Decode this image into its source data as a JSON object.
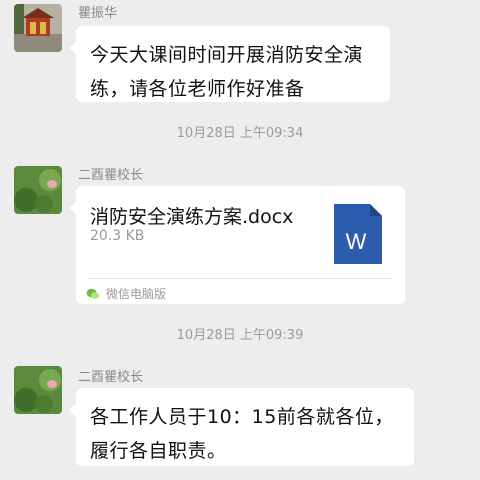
{
  "messages": [
    {
      "sender": "瞿振华",
      "text": "今天大课间时间开展消防安全演练，请各位老师作好准备"
    },
    {
      "timestamp": "10月28日 上午09:34"
    },
    {
      "sender": "二酉瞿校长",
      "file": {
        "name": "消防安全演练方案.docx",
        "size": "20.3 KB",
        "icon_letter": "W",
        "source": "微信电脑版"
      }
    },
    {
      "timestamp": "10月28日 上午09:39"
    },
    {
      "sender": "二酉瞿校长",
      "text": "各工作人员于10：15前各就各位，履行各自职责。"
    }
  ],
  "colors": {
    "background": "#ededed",
    "bubble": "#ffffff",
    "word_icon": "#2b5cad",
    "meta_text": "#8a8a8a"
  },
  "icons": [
    "avatar-temple-photo",
    "avatar-lotus-photo",
    "word-doc-icon",
    "wechat-icon"
  ]
}
